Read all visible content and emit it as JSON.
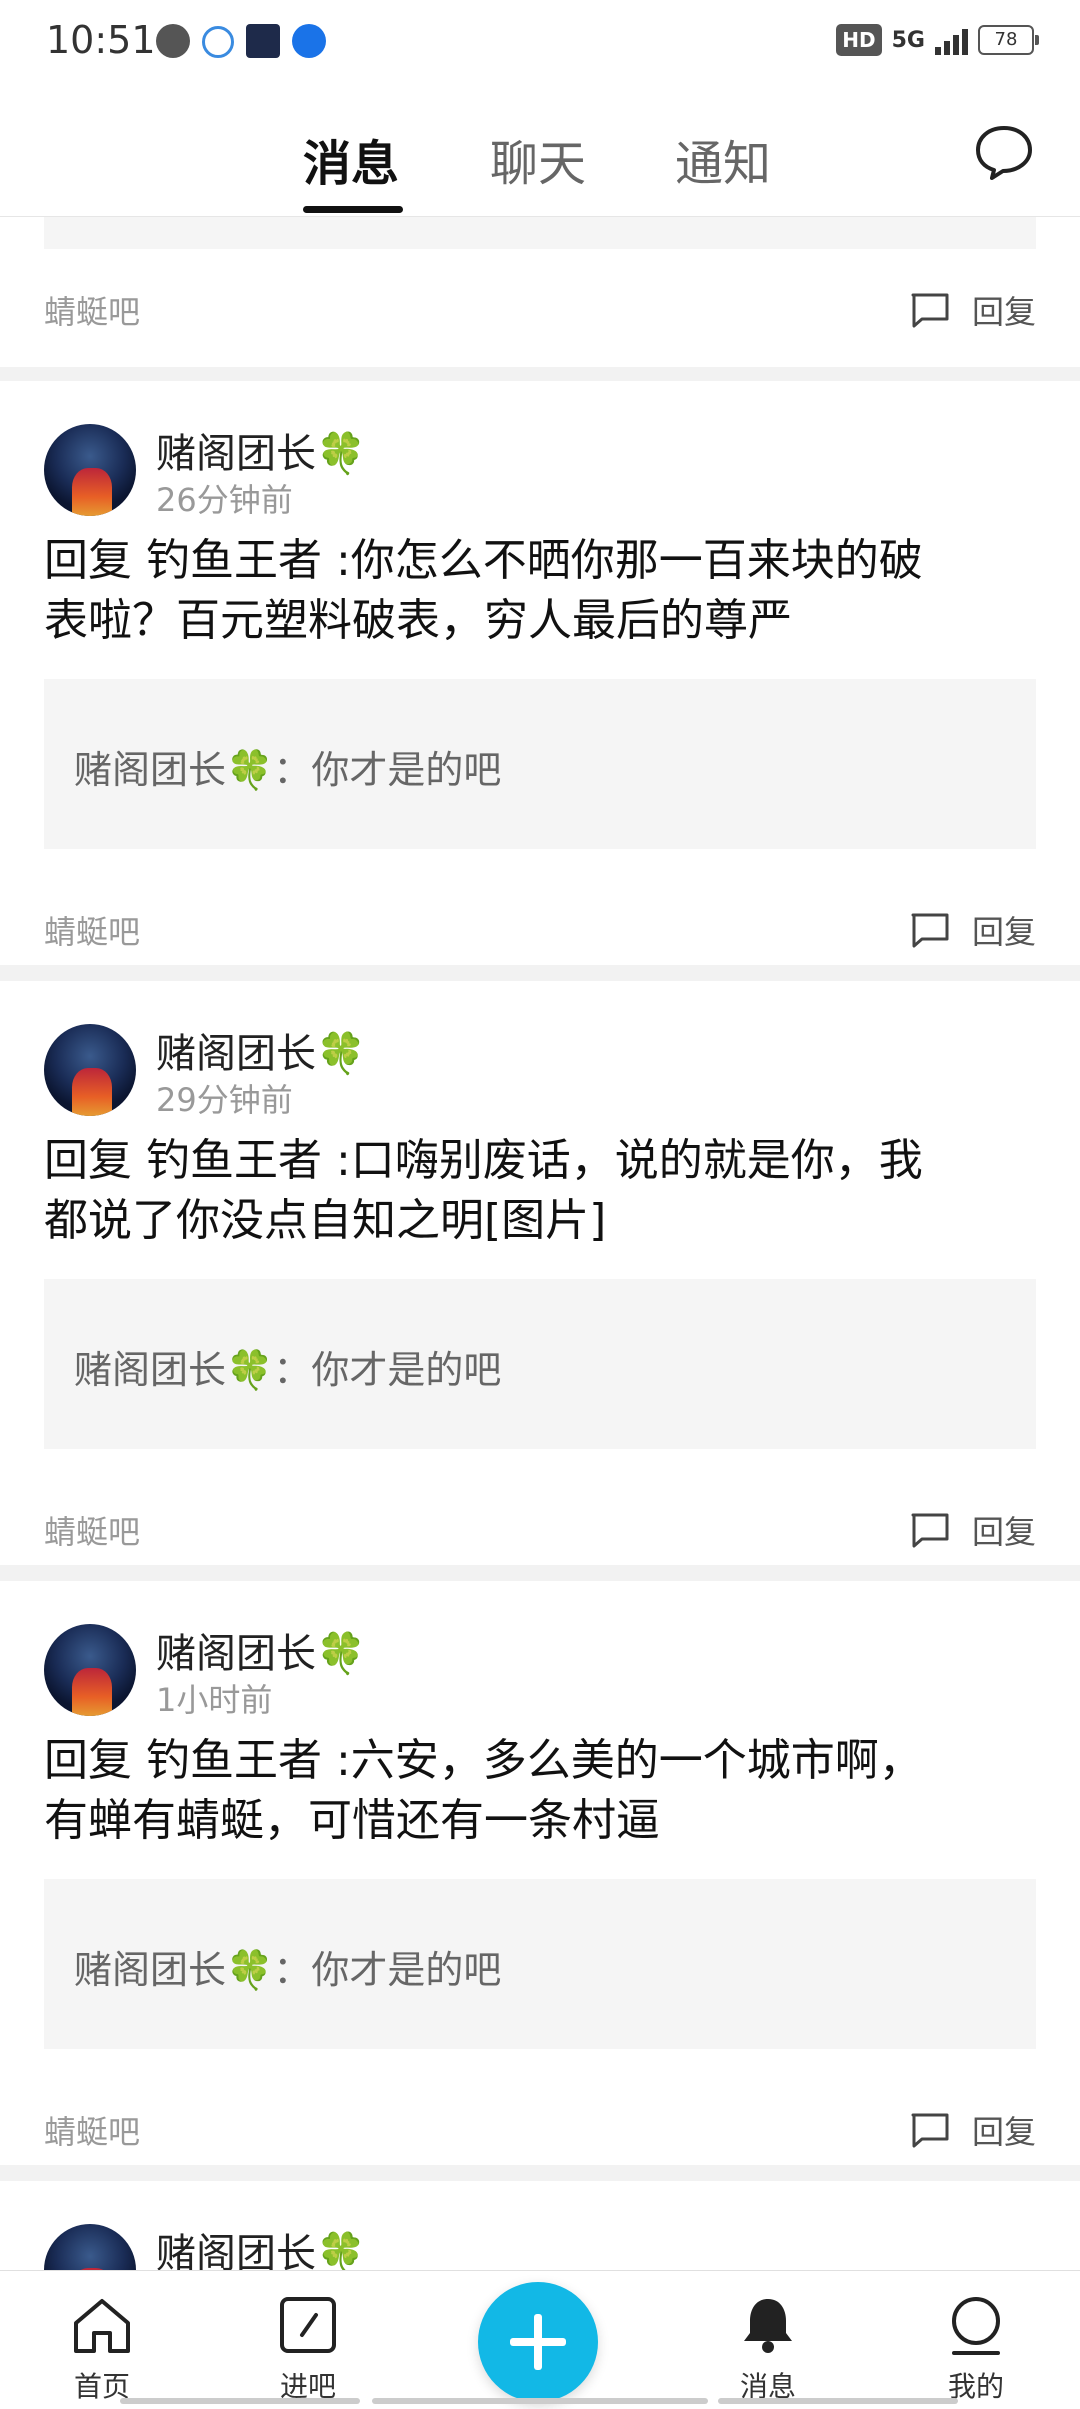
{
  "status_bar": {
    "time": "10:51",
    "network": "5G",
    "hd": "HD",
    "battery": "78"
  },
  "header": {
    "tabs": [
      "消息",
      "聊天",
      "通知"
    ],
    "active_tab": "消息"
  },
  "partial_top": {
    "forum": "蜻蜓吧",
    "reply_label": "回复"
  },
  "cards": [
    {
      "user": "赌阁团长🍀",
      "time": "26分钟前",
      "body_line1": "回复  钓鱼王者  :你怎么不晒你那一百来块的破",
      "body_line2": "表啦？百元塑料破表，穷人最后的尊严",
      "quote": "赌阁团长🍀：你才是的吧",
      "forum": "蜻蜓吧",
      "reply_label": "回复"
    },
    {
      "user": "赌阁团长🍀",
      "time": "29分钟前",
      "body_line1": "回复  钓鱼王者  :口嗨别废话，说的就是你，我",
      "body_line2": "都说了你没点自知之明[图片]",
      "quote": "赌阁团长🍀：你才是的吧",
      "forum": "蜻蜓吧",
      "reply_label": "回复"
    },
    {
      "user": "赌阁团长🍀",
      "time": "1小时前",
      "body_line1": "回复  钓鱼王者  :六安，多么美的一个城市啊，",
      "body_line2": "有蝉有蜻蜓，可惜还有一条村逼",
      "quote": "赌阁团长🍀：你才是的吧",
      "forum": "蜻蜓吧",
      "reply_label": "回复"
    },
    {
      "user": "赌阁团长🍀"
    }
  ],
  "bottom_nav": {
    "items": [
      "首页",
      "进吧",
      "消息",
      "我的"
    ]
  },
  "colors": {
    "accent": "#12b8e6"
  }
}
